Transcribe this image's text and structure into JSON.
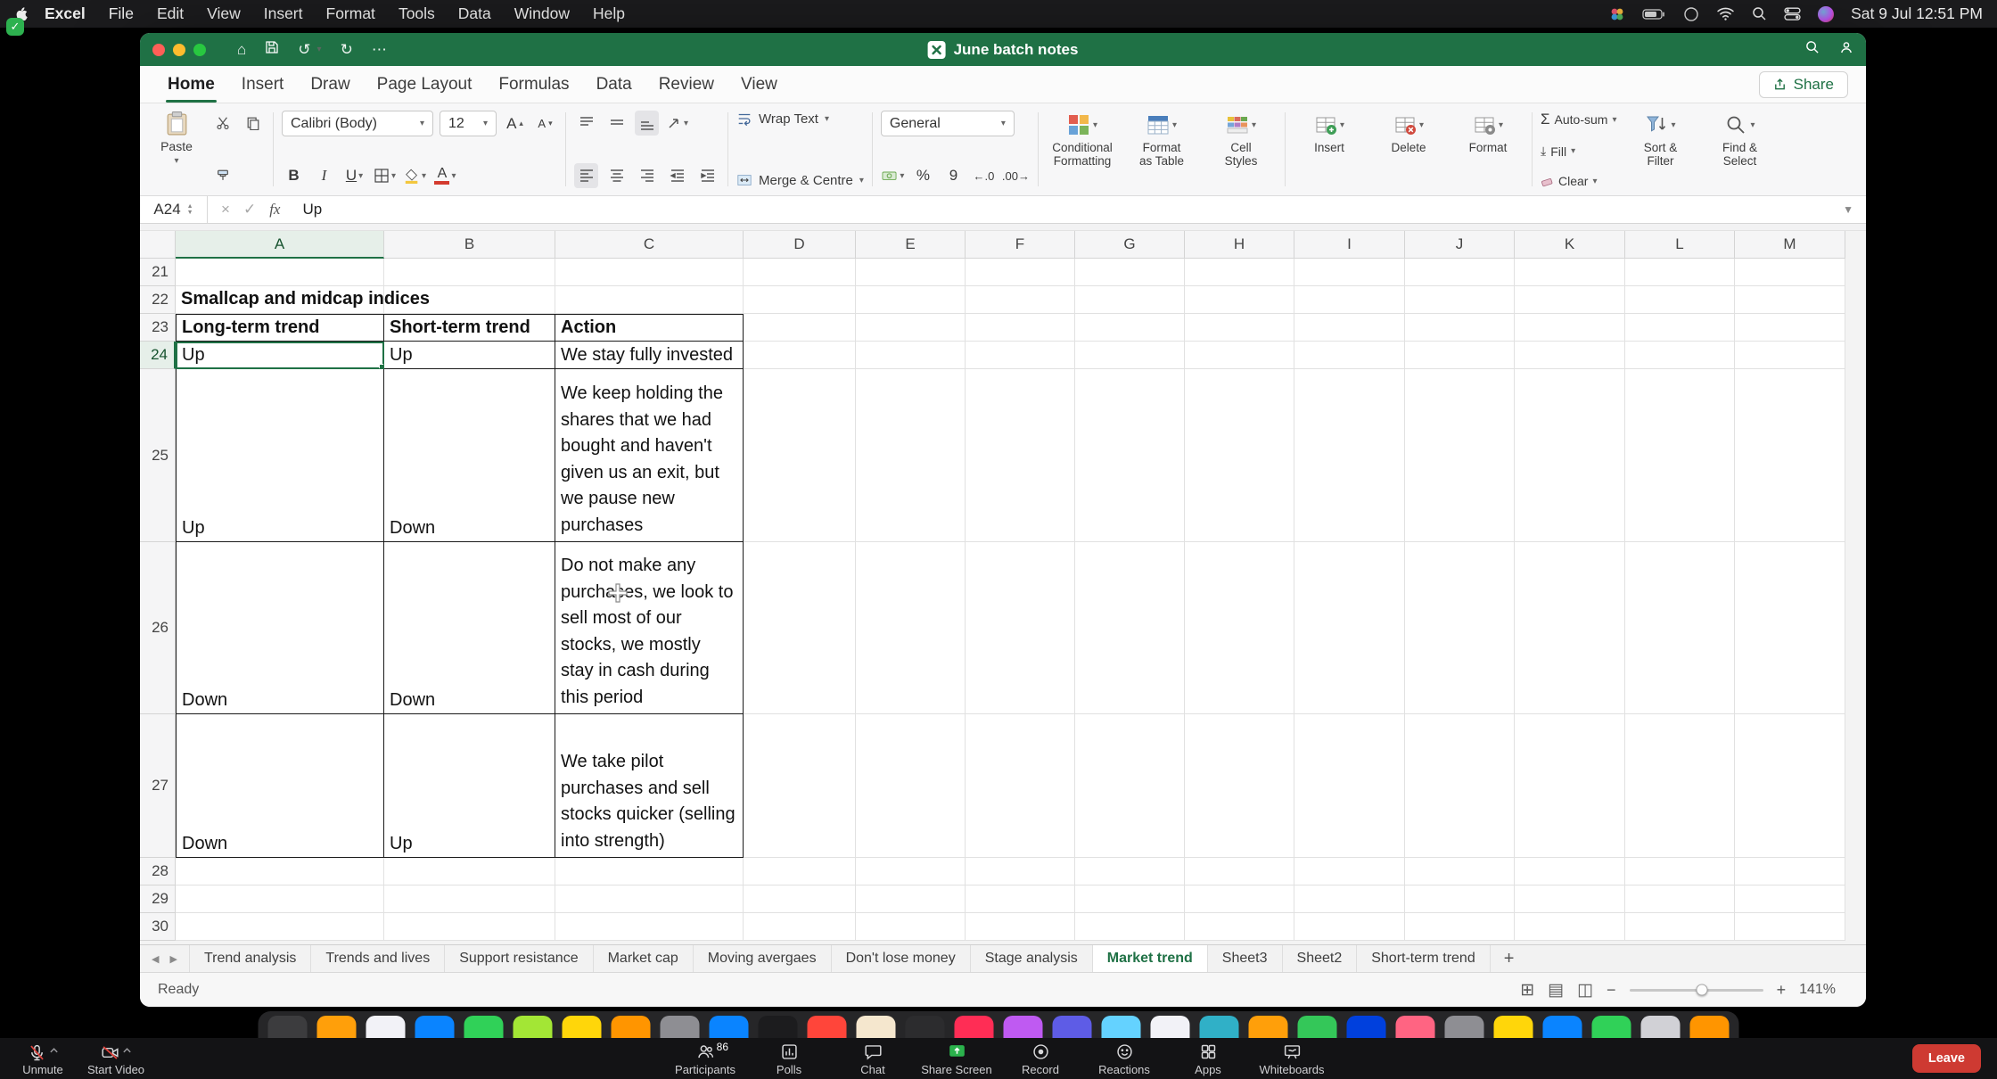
{
  "colors": {
    "excel_green": "#1F7145",
    "selection_green": "#1F7145",
    "leave_red": "#CE3A32",
    "share_screen_green": "#2BB24C",
    "mute_slash_red": "#E0443E"
  },
  "menubar": {
    "app_name": "Excel",
    "items": [
      "File",
      "Edit",
      "View",
      "Insert",
      "Format",
      "Tools",
      "Data",
      "Window",
      "Help"
    ],
    "clock": "Sat 9 Jul 12:51 PM"
  },
  "titlebar": {
    "title": "June batch notes"
  },
  "ribbon_tabs": {
    "tabs": [
      "Home",
      "Insert",
      "Draw",
      "Page Layout",
      "Formulas",
      "Data",
      "Review",
      "View"
    ],
    "active": "Home",
    "share_label": "Share"
  },
  "ribbon": {
    "paste_label": "Paste",
    "font_name": "Calibri (Body)",
    "font_size": "12",
    "bold_label": "B",
    "italic_label": "I",
    "underline_label": "U",
    "a_label": "A",
    "wrap_text_label": "Wrap Text",
    "merge_label": "Merge & Centre",
    "number_format": "General",
    "percent_label": "%",
    "comma_label": "9",
    "dec_dec_label": "←.0",
    "dec_inc_label": ".00→",
    "conditional_l1": "Conditional",
    "conditional_l2": "Formatting",
    "format_table_l1": "Format",
    "format_table_l2": "as Table",
    "cell_styles_l1": "Cell",
    "cell_styles_l2": "Styles",
    "insert_label": "Insert",
    "delete_label": "Delete",
    "format_label": "Format",
    "autosum_label": "Auto-sum",
    "fill_label": "Fill",
    "clear_label": "Clear",
    "sort_filter_l1": "Sort &",
    "sort_filter_l2": "Filter",
    "find_select_l1": "Find &",
    "find_select_l2": "Select"
  },
  "formula_bar": {
    "name_box": "A24",
    "fx_label": "fx",
    "value": "Up"
  },
  "sheet": {
    "columns": [
      "A",
      "B",
      "C",
      "D",
      "E",
      "F",
      "G",
      "H",
      "I",
      "J",
      "K",
      "L",
      "M"
    ],
    "rows": [
      21,
      22,
      23,
      24,
      25,
      26,
      27,
      28,
      29,
      30
    ],
    "selected_cell": "A24",
    "title_row_text": "Smallcap and midcap indices",
    "table_headers": [
      "Long-term trend",
      "Short-term trend",
      "Action"
    ],
    "table_rows": [
      [
        "Up",
        "Up",
        "We stay fully invested"
      ],
      [
        "Up",
        "Down",
        "We keep holding the shares that we had bought and haven't given us an exit, but we pause new purchases"
      ],
      [
        "Down",
        "Down",
        "Do not make any purchases, we look to sell most of our stocks, we mostly stay in cash during this period"
      ],
      [
        "Down",
        "Up",
        "We take pilot purchases and sell stocks quicker (selling into strength)"
      ]
    ]
  },
  "sheet_tabs": {
    "tabs": [
      "Trend analysis",
      "Trends and lives",
      "Support resistance",
      "Market cap",
      "Moving avergaes",
      "Don't lose money",
      "Stage analysis",
      "Market trend",
      "Sheet3",
      "Sheet2",
      "Short-term trend"
    ],
    "active": "Market trend",
    "add_label": "+"
  },
  "status_bar": {
    "status": "Ready",
    "zoom_level": "141%"
  },
  "zoom_bar": {
    "left": [
      {
        "icon": "mic",
        "label": "Unmute"
      },
      {
        "icon": "cam",
        "label": "Start Video"
      }
    ],
    "center": [
      {
        "icon": "participants",
        "label": "Participants",
        "badge": "86"
      },
      {
        "icon": "polls",
        "label": "Polls"
      },
      {
        "icon": "chat",
        "label": "Chat"
      },
      {
        "icon": "share",
        "label": "Share Screen"
      },
      {
        "icon": "record",
        "label": "Record"
      },
      {
        "icon": "reactions",
        "label": "Reactions"
      },
      {
        "icon": "apps",
        "label": "Apps"
      },
      {
        "icon": "whiteboards",
        "label": "Whiteboards"
      }
    ],
    "leave": "Leave"
  },
  "dock": {
    "icon_colors": [
      "#3c3c3e",
      "#ff9f0a",
      "#f2f2f7",
      "#0a84ff",
      "#30d158",
      "#a3e635",
      "#ffd60a",
      "#ff9500",
      "#8e8e93",
      "#0a84ff",
      "#1c1c1e",
      "#ff453a",
      "#f5e7ce",
      "#2c2c2e",
      "#ff2d55",
      "#bf5af2",
      "#5e5ce6",
      "#64d2ff",
      "#f2f2f7",
      "#30b0c7",
      "#ff9f0a",
      "#34c759",
      "#0040dd",
      "#ff6482",
      "#8e8e93",
      "#ffd60a",
      "#0a84ff",
      "#30d158",
      "#d1d1d6",
      "#ff9500"
    ]
  }
}
